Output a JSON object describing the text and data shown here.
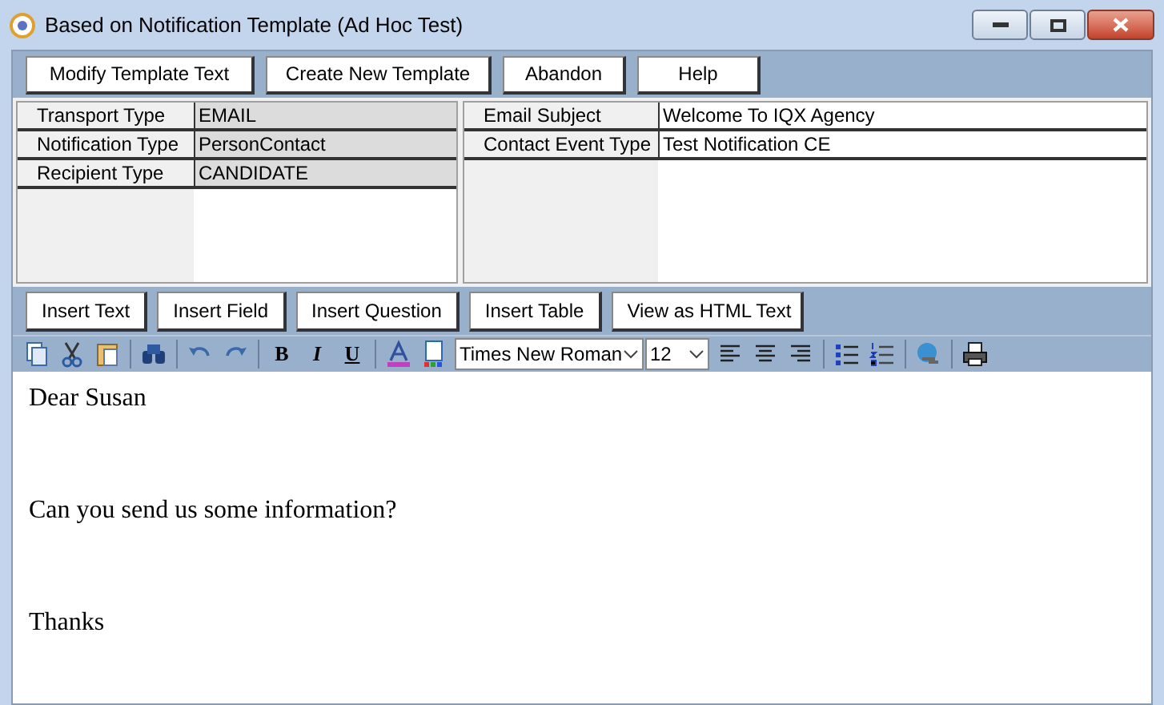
{
  "window": {
    "title": "Based on Notification Template (Ad Hoc Test)"
  },
  "toolbar": {
    "buttons": [
      "Modify Template Text",
      "Create New Template",
      "Abandon",
      "Help"
    ]
  },
  "left_grid": {
    "rows": [
      {
        "label": "Transport Type",
        "value": "EMAIL"
      },
      {
        "label": "Notification Type",
        "value": "PersonContact"
      },
      {
        "label": "Recipient Type",
        "value": "CANDIDATE"
      }
    ]
  },
  "right_grid": {
    "rows": [
      {
        "label": "Email Subject",
        "value": "Welcome To IQX Agency"
      },
      {
        "label": "Contact Event Type",
        "value": "Test Notification CE"
      }
    ]
  },
  "editor_buttons": [
    "Insert Text",
    "Insert Field",
    "Insert Question",
    "Insert Table",
    "View as HTML Text"
  ],
  "format_toolbar": {
    "style_buttons": [
      "B",
      "I",
      "U"
    ],
    "font": "Times New Roman",
    "size": "12"
  },
  "editor": {
    "paragraphs": [
      "Dear Susan",
      "Can you send us some information?",
      "Thanks"
    ]
  }
}
